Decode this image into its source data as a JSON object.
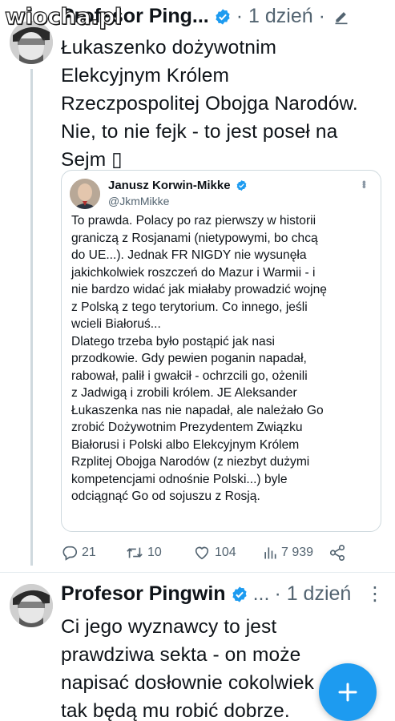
{
  "watermark": "wiocha.pl",
  "colors": {
    "accent": "#1d9bf0",
    "muted": "#536471",
    "text": "#0f1419",
    "border": "#cfd9de"
  },
  "tweet1": {
    "author_name": "Profesor Ping...",
    "verified": "verified-badge-icon",
    "time": "· 1 dzień ·",
    "edit_icon": "edit-icon",
    "text_lines": [
      "Łukaszenko dożywotnim",
      "Elekcyjnym Królem",
      "Rzeczpospolitej Obojga Narodów.",
      "Nie, to nie fejk - to jest poseł na",
      "Sejm ▯"
    ],
    "quote": {
      "author_name": "Janusz Korwin-Mikke",
      "handle": "@JkmMikke",
      "body_lines": [
        "To prawda. Polacy po raz pierwszy w historii",
        "graniczą z Rosjanami (nietypowymi, bo chcą",
        "do UE...). Jednak FR NIGDY nie wysunęła",
        "jakichkolwiek roszczeń do Mazur i Warmii - i",
        "nie bardzo widać jak miałaby prowadzić wojnę",
        "z Polską z tego terytorium. Co innego, jeśli",
        "wcieli Białoruś...",
        "Dlatego trzeba było postąpić jak nasi",
        "przodkowie. Gdy pewien poganin napadał,",
        "rabował, palił i gwałcił - ochrzcili go, ożenili",
        "z Jadwigą i zrobili królem. JE Aleksander",
        "Łukaszenka nas nie napadał, ale należało Go",
        "zrobić Dożywotnim Prezydentem Związku",
        "Białorusi i Polski albo Elekcyjnym Królem",
        "Rzplitej Obojga Narodów (z niezbyt dużymi",
        "kompetencjami odnośnie Polski...) byle",
        "odciągnąć Go od sojuszu z Rosją."
      ]
    },
    "actions": {
      "replies": "21",
      "retweets": "10",
      "likes": "104",
      "views": "7 939"
    }
  },
  "tweet2": {
    "author_name": "Profesor Pingwin",
    "verified": "verified-badge-icon",
    "ellipsis": "...",
    "time": "· 1 dzień",
    "text_lines": [
      "Ci jego wyznawcy to jest",
      "prawdziwa sekta - on może",
      "napisać dosłownie cokolwiek",
      "tak będą mu robić dobrze."
    ]
  },
  "fab": {
    "icon": "plus-icon"
  }
}
